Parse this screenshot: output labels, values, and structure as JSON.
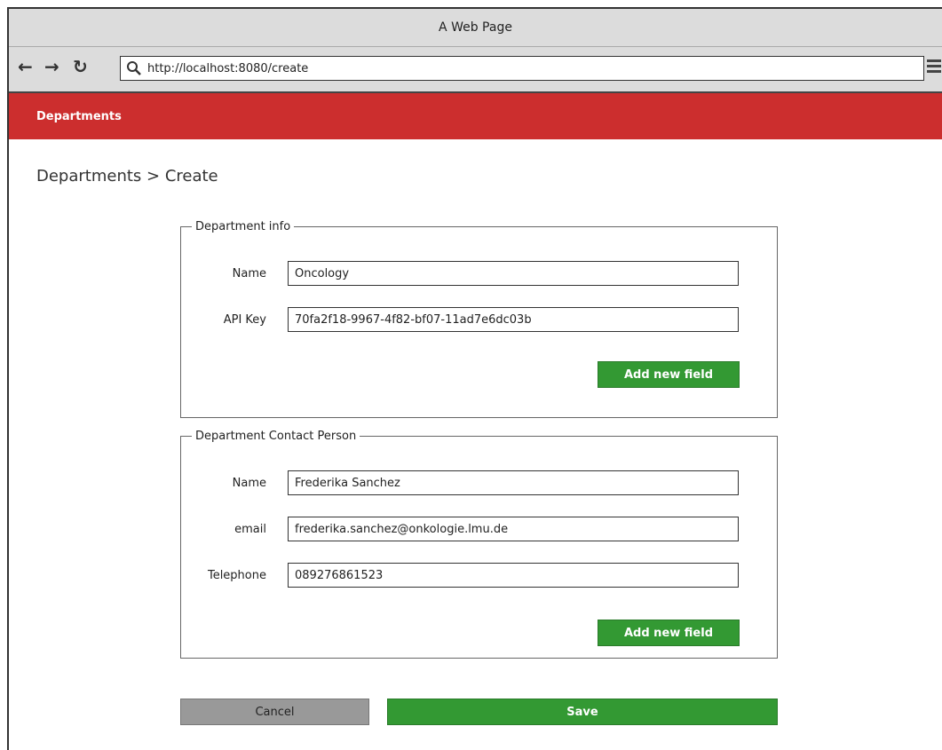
{
  "window": {
    "title": "A Web Page"
  },
  "browser": {
    "url": "http://localhost:8080/create"
  },
  "navbar": {
    "brand": "Departments"
  },
  "breadcrumb": "Departments > Create",
  "department_info": {
    "legend": "Department info",
    "fields": [
      {
        "label": "Name",
        "value": "Oncology"
      },
      {
        "label": "API Key",
        "value": "70fa2f18-9967-4f82-bf07-11ad7e6dc03b"
      }
    ],
    "add_button": "Add new field"
  },
  "contact_person": {
    "legend": "Department Contact Person",
    "fields": [
      {
        "label": "Name",
        "value": "Frederika Sanchez"
      },
      {
        "label": "email",
        "value": "frederika.sanchez@onkologie.lmu.de"
      },
      {
        "label": "Telephone",
        "value": "089276861523"
      }
    ],
    "add_button": "Add new field"
  },
  "actions": {
    "cancel": "Cancel",
    "save": "Save"
  },
  "colors": {
    "navbar": "#cc2e2e",
    "primary_button": "#339933",
    "cancel_button": "#999999"
  }
}
